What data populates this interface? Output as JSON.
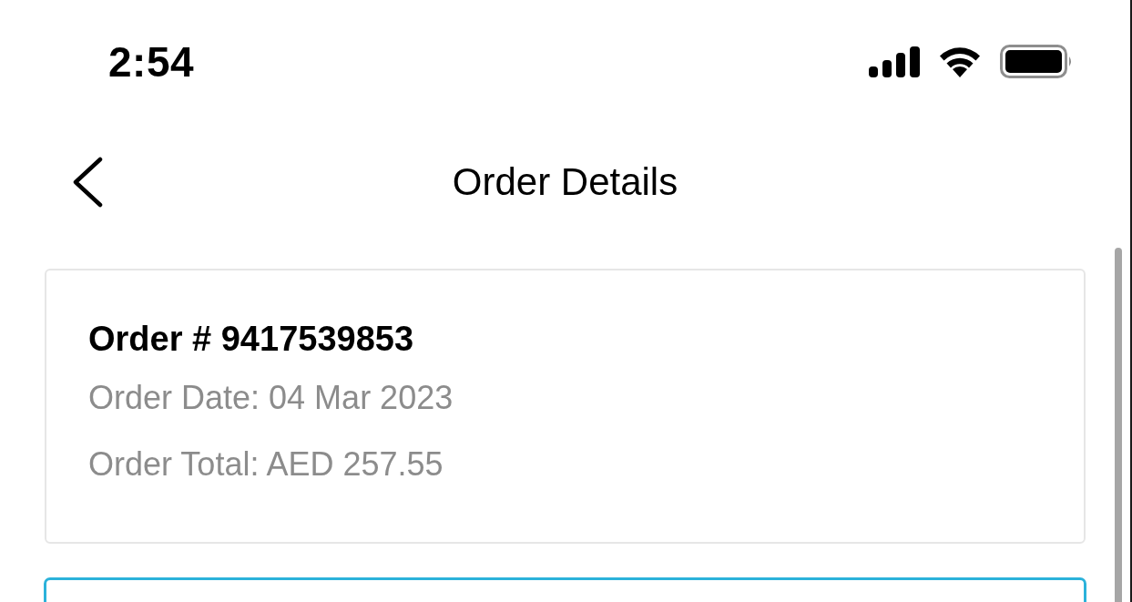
{
  "status_bar": {
    "time": "2:54"
  },
  "nav": {
    "title": "Order Details"
  },
  "order": {
    "number": "Order # 9417539853",
    "date": "Order Date: 04 Mar 2023",
    "total": "Order Total: AED 257.55"
  }
}
